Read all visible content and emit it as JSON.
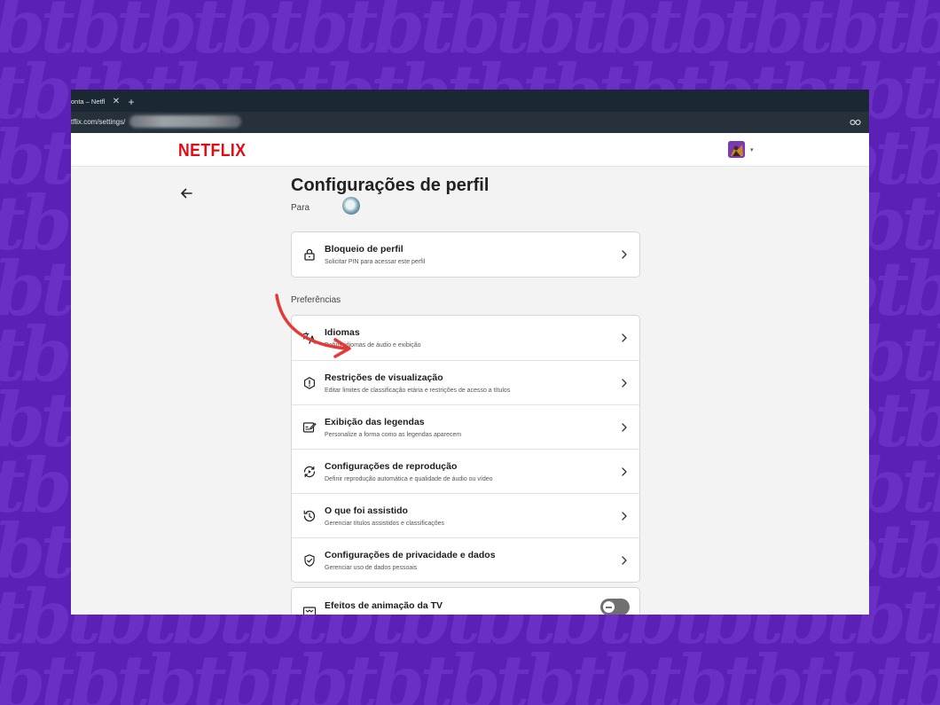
{
  "browser": {
    "tab_title": "onta – Netfl",
    "tab_close": "✕",
    "new_tab": "+",
    "url_prefix": "tflix.com/settings/"
  },
  "header": {
    "logo": "NETFLIX",
    "avatar_caret": "▾"
  },
  "page": {
    "title": "Configurações de perfil",
    "for_label": "Para"
  },
  "profile_lock": {
    "title": "Bloqueio de perfil",
    "subtitle": "Solicitar PIN para acessar este perfil",
    "icon": "lock-icon"
  },
  "preferences": {
    "label": "Preferências",
    "items": [
      {
        "title": "Idiomas",
        "subtitle": "Definir idiomas de áudio e exibição",
        "icon": "translate-icon"
      },
      {
        "title": "Restrições de visualização",
        "subtitle": "Editar limites de classificação etária e restrições de acesso a títulos",
        "icon": "alert-circle-icon"
      },
      {
        "title": "Exibição das legendas",
        "subtitle": "Personalize a forma como as legendas aparecem",
        "icon": "subtitles-edit-icon"
      },
      {
        "title": "Configurações de reprodução",
        "subtitle": "Definir reprodução automática e qualidade de áudio ou vídeo",
        "icon": "playback-refresh-icon"
      },
      {
        "title": "O que foi assistido",
        "subtitle": "Gerenciar títulos assistidos e classificações",
        "icon": "history-icon"
      },
      {
        "title": "Configurações de privacidade e dados",
        "subtitle": "Gerenciar uso de dados pessoais",
        "icon": "shield-check-icon"
      }
    ]
  },
  "tv_animation": {
    "title": "Efeitos de animação da TV",
    "icon": "tv-icon",
    "toggle_on": false
  },
  "colors": {
    "brand": "#e50914",
    "background_purple": "#5b20b6",
    "annotation_arrow": "#e53935"
  }
}
